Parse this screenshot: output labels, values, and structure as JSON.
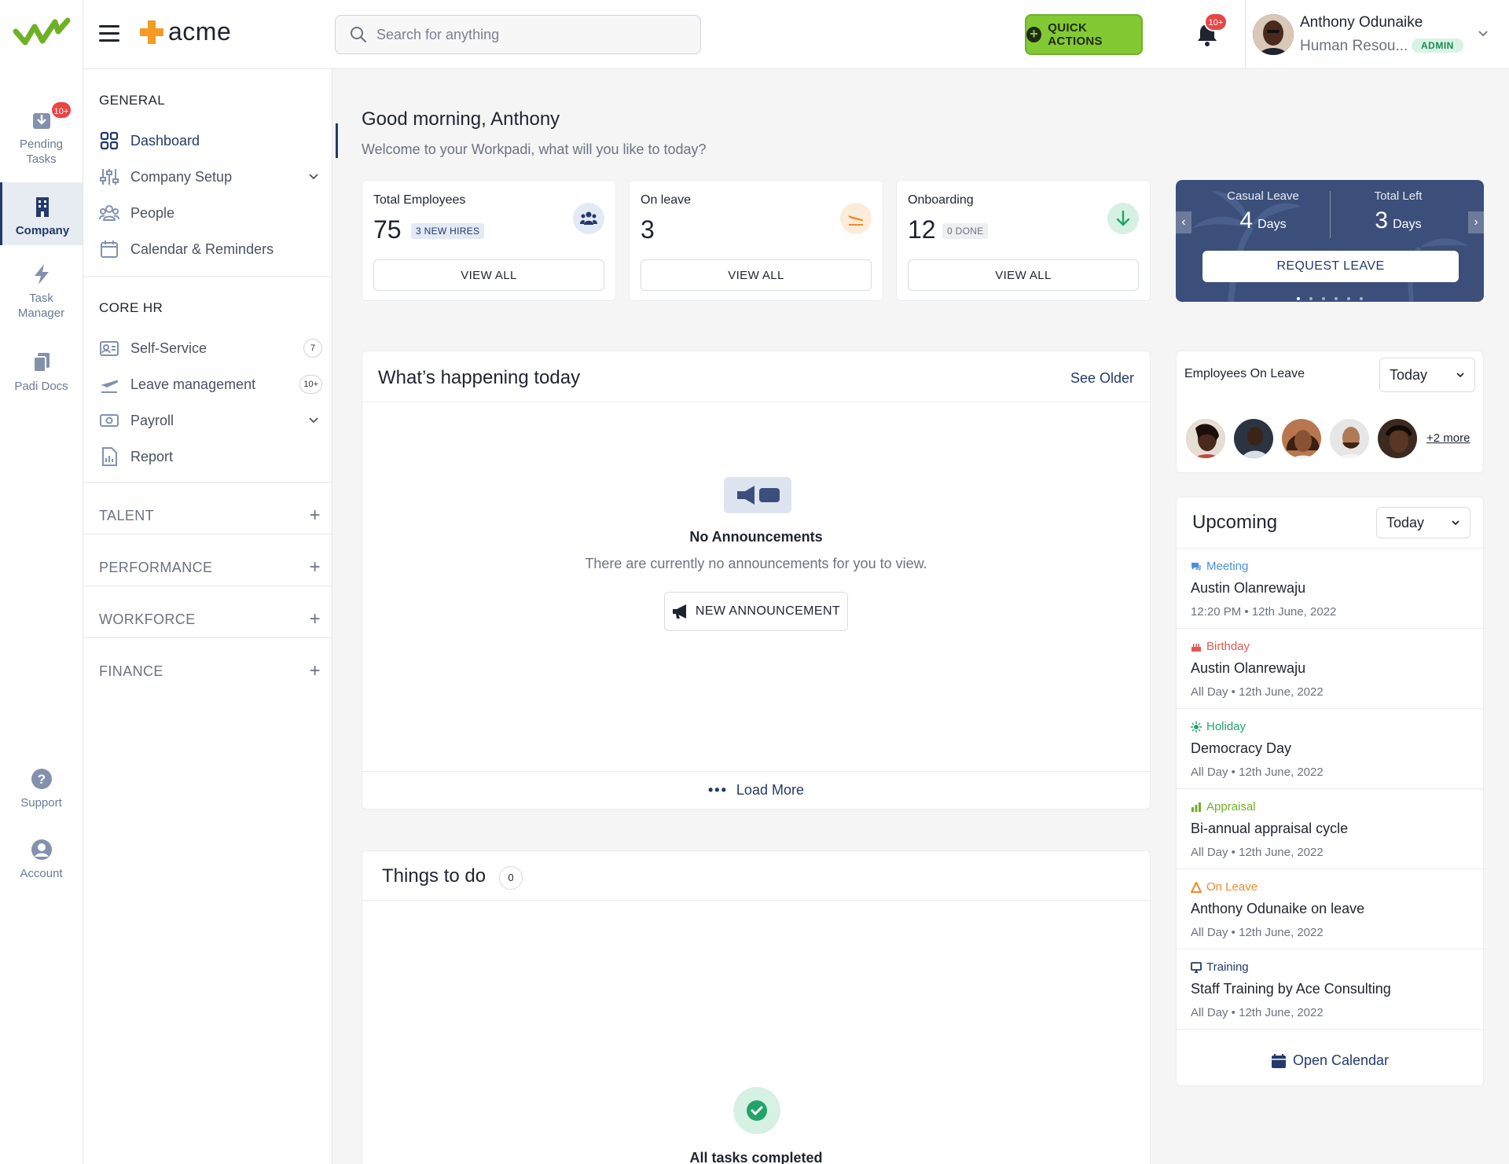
{
  "rail": {
    "items": [
      {
        "label": "Pending\nTasks",
        "icon": "pending-tasks-icon",
        "badge": "10+"
      },
      {
        "label": "Company",
        "icon": "company-icon",
        "active": true
      },
      {
        "label": "Task\nManager",
        "icon": "lightning-icon"
      },
      {
        "label": "Padi Docs",
        "icon": "docs-icon"
      },
      {
        "label": "Support",
        "icon": "help-icon"
      },
      {
        "label": "Account",
        "icon": "account-icon"
      }
    ]
  },
  "topbar": {
    "brand": "acme",
    "search_placeholder": "Search for anything",
    "quick_actions": "QUICK ACTIONS",
    "notif_badge": "10+",
    "user_name": "Anthony Odunaike",
    "user_role": "Human Resou...",
    "user_badge": "ADMIN"
  },
  "sidebar": {
    "general_title": "GENERAL",
    "general": [
      {
        "label": "Dashboard",
        "icon": "grid-icon",
        "active": true
      },
      {
        "label": "Company Setup",
        "icon": "sliders-icon",
        "chevron": true
      },
      {
        "label": "People",
        "icon": "people-icon"
      },
      {
        "label": "Calendar & Reminders",
        "icon": "calendar-icon"
      }
    ],
    "core_title": "CORE HR",
    "core": [
      {
        "label": "Self-Service",
        "icon": "id-card-icon",
        "count": "7"
      },
      {
        "label": "Leave management",
        "icon": "plane-icon",
        "count": "10+"
      },
      {
        "label": "Payroll",
        "icon": "money-icon",
        "chevron": true
      },
      {
        "label": "Report",
        "icon": "report-icon"
      }
    ],
    "groups": [
      "TALENT",
      "PERFORMANCE",
      "WORKFORCE",
      "FINANCE"
    ]
  },
  "main": {
    "greeting": "Good morning, Anthony",
    "subtitle": "Welcome to your Workpadi, what will you like to today?",
    "stats": [
      {
        "label": "Total Employees",
        "value": "75",
        "chip": "3 NEW HIRES",
        "button": "VIEW ALL",
        "icon": "team-icon",
        "chip_bg": "#e3eaf6",
        "chip_fg": "#233a6b",
        "icon_bg": "#e3eaf6"
      },
      {
        "label": "On leave",
        "value": "3",
        "chip": "",
        "button": "VIEW ALL",
        "icon": "plane-land-icon",
        "icon_bg": "#fdecd9"
      },
      {
        "label": "Onboarding",
        "value": "12",
        "chip": "0 DONE",
        "button": "VIEW ALL",
        "icon": "arrow-down-icon",
        "chip_bg": "#eeeff1",
        "chip_fg": "#6c7380",
        "icon_bg": "#d6f1e3"
      }
    ],
    "leave_card": {
      "casual_label": "Casual Leave",
      "casual_value": "4",
      "total_label": "Total Left",
      "total_value": "3",
      "unit": "Days",
      "button": "REQUEST LEAVE"
    },
    "happening": {
      "title": "What’s happening today",
      "see_older": "See Older",
      "empty_title": "No Announcements",
      "empty_sub": "There are currently no announcements for you to view.",
      "new_button": "NEW ANNOUNCEMENT",
      "load_more": "Load More"
    },
    "todo": {
      "title": "Things to do",
      "count": "0",
      "done_text": "All tasks completed"
    },
    "on_leave": {
      "title": "Employees On Leave",
      "filter": "Today",
      "more": "+2 more"
    },
    "upcoming": {
      "title": "Upcoming",
      "filter": "Today",
      "items": [
        {
          "type": "Meeting",
          "color": "#4a90d9",
          "icon": "chat-icon",
          "name": "Austin Olanrewaju",
          "time": "12:20 PM • 12th June, 2022"
        },
        {
          "type": "Birthday",
          "color": "#e05a4f",
          "icon": "cake-icon",
          "name": "Austin Olanrewaju",
          "time": "All Day • 12th June, 2022"
        },
        {
          "type": "Holiday",
          "color": "#22a36b",
          "icon": "sun-icon",
          "name": "Democracy Day",
          "time": "All Day • 12th June, 2022"
        },
        {
          "type": "Appraisal",
          "color": "#6fb126",
          "icon": "bars-icon",
          "name": "Bi-annual appraisal cycle",
          "time": "All Day • 12th June, 2022"
        },
        {
          "type": "On Leave",
          "color": "#ef8c2d",
          "icon": "warning-icon",
          "name": "Anthony Odunaike on leave",
          "time": "All Day • 12th June, 2022"
        },
        {
          "type": "Training",
          "color": "#233a6b",
          "icon": "monitor-icon",
          "name": "Staff Training by Ace Consulting",
          "time": "All Day • 12th June, 2022"
        }
      ],
      "open_calendar": "Open Calendar"
    }
  }
}
